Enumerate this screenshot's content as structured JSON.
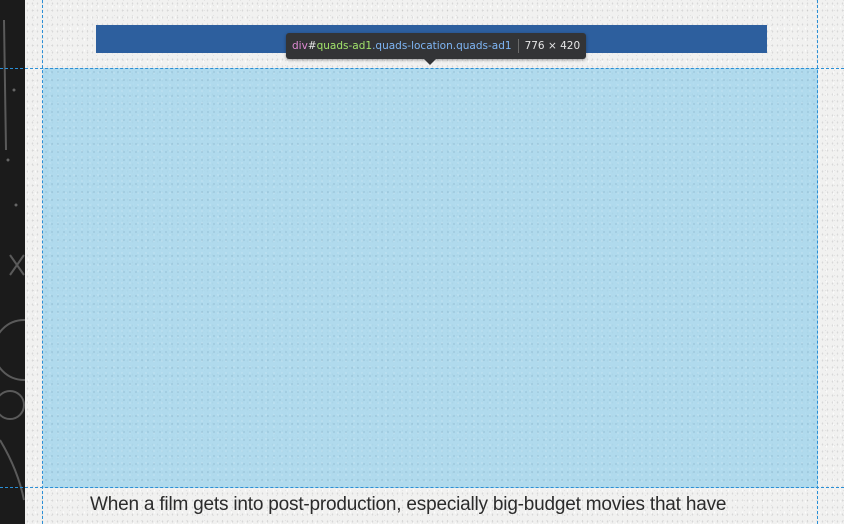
{
  "inspector_tooltip": {
    "tag": "div",
    "id_prefix": "#",
    "id": "quads-ad1",
    "classes": ".quads-location.quads-ad1",
    "dimensions": "776 × 420"
  },
  "article": {
    "visible_line": "When a film gets into post-production, especially big-budget movies that have"
  },
  "colors": {
    "highlight": "#a0d4ec",
    "guide_lines": "#2a8fd6",
    "blue_bar": "#2d5f9e",
    "tooltip_bg": "#333436"
  }
}
